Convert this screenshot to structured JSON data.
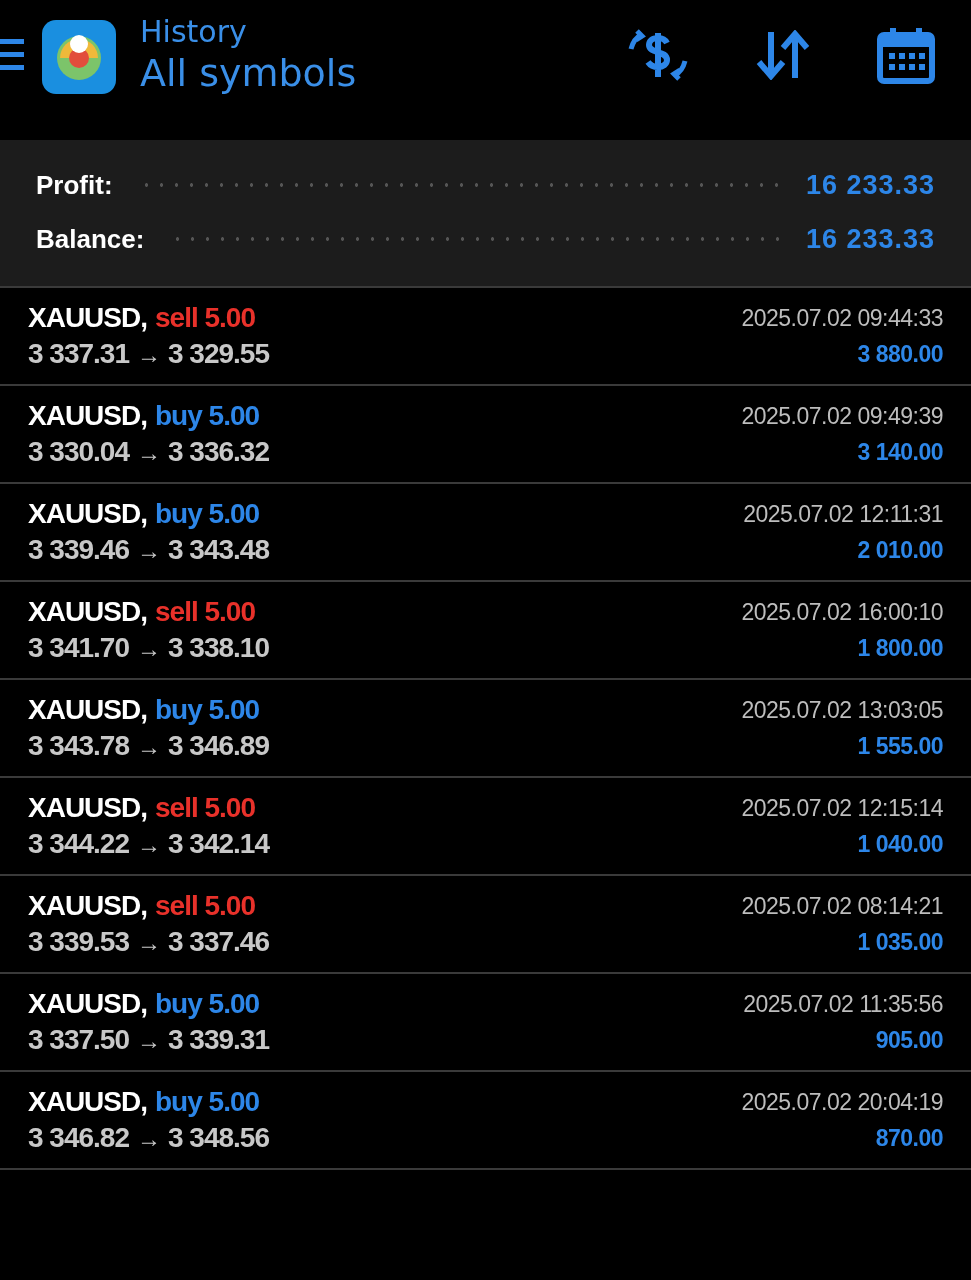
{
  "header": {
    "subtitle": "History",
    "title": "All symbols"
  },
  "summary": [
    {
      "label": "Profit:",
      "value": "16 233.33"
    },
    {
      "label": "Balance:",
      "value": "16 233.33"
    }
  ],
  "deals": [
    {
      "symbol": "XAUUSD,",
      "kind": "sell",
      "side": "sell",
      "volume": "5.00",
      "open": "3 337.31",
      "arrow": "→",
      "close": "3 329.55",
      "time": "2025.07.02 09:44:33",
      "profit": "3 880.00"
    },
    {
      "symbol": "XAUUSD,",
      "kind": "buy",
      "side": "buy",
      "volume": "5.00",
      "open": "3 330.04",
      "arrow": "→",
      "close": "3 336.32",
      "time": "2025.07.02 09:49:39",
      "profit": "3 140.00"
    },
    {
      "symbol": "XAUUSD,",
      "kind": "buy",
      "side": "buy",
      "volume": "5.00",
      "open": "3 339.46",
      "arrow": "→",
      "close": "3 343.48",
      "time": "2025.07.02 12:11:31",
      "profit": "2 010.00"
    },
    {
      "symbol": "XAUUSD,",
      "kind": "sell",
      "side": "sell",
      "volume": "5.00",
      "open": "3 341.70",
      "arrow": "→",
      "close": "3 338.10",
      "time": "2025.07.02 16:00:10",
      "profit": "1 800.00"
    },
    {
      "symbol": "XAUUSD,",
      "kind": "buy",
      "side": "buy",
      "volume": "5.00",
      "open": "3 343.78",
      "arrow": "→",
      "close": "3 346.89",
      "time": "2025.07.02 13:03:05",
      "profit": "1 555.00"
    },
    {
      "symbol": "XAUUSD,",
      "kind": "sell",
      "side": "sell",
      "volume": "5.00",
      "open": "3 344.22",
      "arrow": "→",
      "close": "3 342.14",
      "time": "2025.07.02 12:15:14",
      "profit": "1 040.00"
    },
    {
      "symbol": "XAUUSD,",
      "kind": "sell",
      "side": "sell",
      "volume": "5.00",
      "open": "3 339.53",
      "arrow": "→",
      "close": "3 337.46",
      "time": "2025.07.02 08:14:21",
      "profit": "1 035.00"
    },
    {
      "symbol": "XAUUSD,",
      "kind": "buy",
      "side": "buy",
      "volume": "5.00",
      "open": "3 337.50",
      "arrow": "→",
      "close": "3 339.31",
      "time": "2025.07.02 11:35:56",
      "profit": "905.00"
    },
    {
      "symbol": "XAUUSD,",
      "kind": "buy",
      "side": "buy",
      "volume": "5.00",
      "open": "3 346.82",
      "arrow": "→",
      "close": "3 348.56",
      "time": "2025.07.02 20:04:19",
      "profit": "870.00"
    }
  ]
}
